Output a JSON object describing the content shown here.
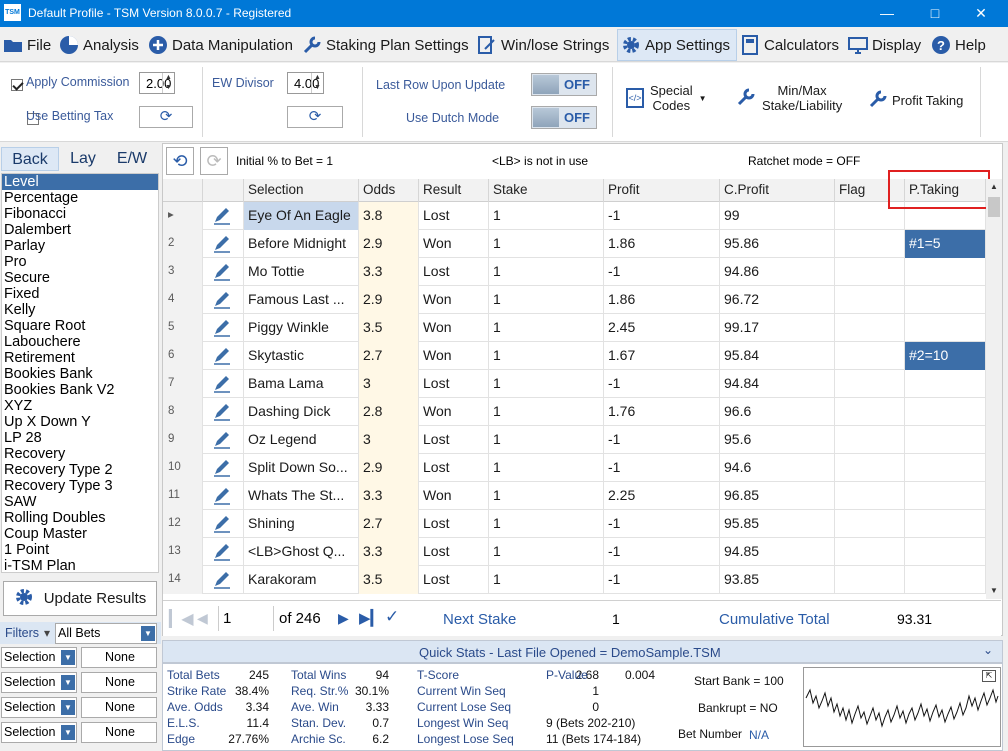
{
  "window": {
    "title": "Default Profile - TSM Version 8.0.0.7 - Registered",
    "logo": "TSM"
  },
  "menu": [
    {
      "label": "File",
      "icon": "folder-icon"
    },
    {
      "label": "Analysis",
      "icon": "pie-chart-icon"
    },
    {
      "label": "Data Manipulation",
      "icon": "plus-circle-icon"
    },
    {
      "label": "Staking Plan Settings",
      "icon": "wrench-icon"
    },
    {
      "label": "Win/lose Strings",
      "icon": "document-edit-icon"
    },
    {
      "label": "App Settings",
      "icon": "gear-icon"
    },
    {
      "label": "Calculators",
      "icon": "calculator-icon"
    },
    {
      "label": "Display",
      "icon": "monitor-icon"
    },
    {
      "label": "Help",
      "icon": "help-icon"
    }
  ],
  "toolbar": {
    "apply_commission": {
      "label": "Apply Commission",
      "checked": true,
      "value": "2.00"
    },
    "use_betting_tax": {
      "label": "Use Betting Tax",
      "checked": false
    },
    "ew_divisor": {
      "label": "EW Divisor",
      "value": "4.00"
    },
    "last_row": {
      "label": "Last Row Upon Update",
      "state": "OFF"
    },
    "dutch_mode": {
      "label": "Use Dutch Mode",
      "state": "OFF"
    },
    "special_codes": "Special\nCodes",
    "min_max": "Min/Max\nStake/Liability",
    "profit_taking": "Profit Taking"
  },
  "left": {
    "tabs": [
      "Back",
      "Lay",
      "E/W"
    ],
    "strategies": [
      "Level",
      "Percentage",
      "Fibonacci",
      "Dalembert",
      "Parlay",
      "Pro",
      "Secure",
      "Fixed",
      "Kelly",
      "Square Root",
      "Labouchere",
      "Retirement",
      "Bookies Bank",
      "Bookies Bank V2",
      "XYZ",
      "Up X Down Y",
      "LP 28",
      "Recovery",
      "Recovery Type 2",
      "Recovery Type 3",
      "SAW",
      "Rolling Doubles",
      "Coup Master",
      "1 Point",
      "i-TSM Plan"
    ],
    "selected": "Level",
    "update_button": "Update Results",
    "filters_label": "Filters",
    "filters_value": "All Bets",
    "filter_rows": [
      {
        "field": "Selection",
        "value": "None"
      },
      {
        "field": "Selection",
        "value": "None"
      },
      {
        "field": "Selection",
        "value": "None"
      },
      {
        "field": "Selection",
        "value": "None"
      }
    ]
  },
  "info": {
    "initial": "Initial % to Bet = 1",
    "lb": "<LB> is not in use",
    "ratchet": "Ratchet mode = OFF"
  },
  "grid": {
    "columns": [
      "Selection",
      "Odds",
      "Result",
      "Stake",
      "Profit",
      "C.Profit",
      "Flag",
      "P.Taking"
    ],
    "rows": [
      {
        "n": "▸",
        "selection": "Eye Of An Eagle",
        "odds": "3.8",
        "result": "Lost",
        "stake": "1",
        "profit": "-1",
        "cprofit": "99",
        "flag": "",
        "ptaking": ""
      },
      {
        "n": "2",
        "selection": "Before Midnight",
        "odds": "2.9",
        "result": "Won",
        "stake": "1",
        "profit": "1.86",
        "cprofit": "95.86",
        "flag": "",
        "ptaking": "#1=5"
      },
      {
        "n": "3",
        "selection": "Mo Tottie",
        "odds": "3.3",
        "result": "Lost",
        "stake": "1",
        "profit": "-1",
        "cprofit": "94.86",
        "flag": "",
        "ptaking": ""
      },
      {
        "n": "4",
        "selection": "Famous Last ...",
        "odds": "2.9",
        "result": "Won",
        "stake": "1",
        "profit": "1.86",
        "cprofit": "96.72",
        "flag": "",
        "ptaking": ""
      },
      {
        "n": "5",
        "selection": "Piggy Winkle",
        "odds": "3.5",
        "result": "Won",
        "stake": "1",
        "profit": "2.45",
        "cprofit": "99.17",
        "flag": "",
        "ptaking": ""
      },
      {
        "n": "6",
        "selection": "Skytastic",
        "odds": "2.7",
        "result": "Won",
        "stake": "1",
        "profit": "1.67",
        "cprofit": "95.84",
        "flag": "",
        "ptaking": "#2=10"
      },
      {
        "n": "7",
        "selection": "Bama Lama",
        "odds": "3",
        "result": "Lost",
        "stake": "1",
        "profit": "-1",
        "cprofit": "94.84",
        "flag": "",
        "ptaking": ""
      },
      {
        "n": "8",
        "selection": "Dashing Dick",
        "odds": "2.8",
        "result": "Won",
        "stake": "1",
        "profit": "1.76",
        "cprofit": "96.6",
        "flag": "",
        "ptaking": ""
      },
      {
        "n": "9",
        "selection": "Oz Legend",
        "odds": "3",
        "result": "Lost",
        "stake": "1",
        "profit": "-1",
        "cprofit": "95.6",
        "flag": "",
        "ptaking": ""
      },
      {
        "n": "10",
        "selection": "Split Down So...",
        "odds": "2.9",
        "result": "Lost",
        "stake": "1",
        "profit": "-1",
        "cprofit": "94.6",
        "flag": "",
        "ptaking": ""
      },
      {
        "n": "11",
        "selection": "Whats The St...",
        "odds": "3.3",
        "result": "Won",
        "stake": "1",
        "profit": "2.25",
        "cprofit": "96.85",
        "flag": "",
        "ptaking": ""
      },
      {
        "n": "12",
        "selection": "Shining",
        "odds": "2.7",
        "result": "Lost",
        "stake": "1",
        "profit": "-1",
        "cprofit": "95.85",
        "flag": "",
        "ptaking": ""
      },
      {
        "n": "13",
        "selection": "<LB>Ghost Q...",
        "odds": "3.3",
        "result": "Lost",
        "stake": "1",
        "profit": "-1",
        "cprofit": "94.85",
        "flag": "",
        "ptaking": ""
      },
      {
        "n": "14",
        "selection": "Karakoram",
        "odds": "3.5",
        "result": "Lost",
        "stake": "1",
        "profit": "-1",
        "cprofit": "93.85",
        "flag": "",
        "ptaking": ""
      }
    ]
  },
  "footer": {
    "page": "1",
    "of": "of 246",
    "next_stake_label": "Next Stake",
    "next_stake": "1",
    "cumulative_label": "Cumulative Total",
    "cumulative": "93.31"
  },
  "quickstats": {
    "title": "Quick Stats - Last File Opened = DemoSample.TSM",
    "col1": [
      {
        "k": "Total Bets",
        "v": "245"
      },
      {
        "k": "Strike Rate",
        "v": "38.4%"
      },
      {
        "k": "Ave. Odds",
        "v": "3.34"
      },
      {
        "k": "E.L.S.",
        "v": "11.4"
      },
      {
        "k": "Edge",
        "v": "27.76%"
      }
    ],
    "col2": [
      {
        "k": "Total Wins",
        "v": "94"
      },
      {
        "k": "Req. Str.%",
        "v": "30.1%"
      },
      {
        "k": "Ave. Win",
        "v": "3.33"
      },
      {
        "k": "Stan. Dev.",
        "v": "0.7"
      },
      {
        "k": "Archie Sc.",
        "v": "6.2"
      }
    ],
    "col3": [
      {
        "k": "T-Score",
        "v": "2.68"
      },
      {
        "k": "Current Win Seq",
        "v": "1"
      },
      {
        "k": "Current Lose Seq",
        "v": "0"
      },
      {
        "k": "Longest Win Seq",
        "v": "9  (Bets 202-210)"
      },
      {
        "k": "Longest Lose Seq",
        "v": "11  (Bets 174-184)"
      }
    ],
    "pvalue_label": "P-Value",
    "pvalue": "0.004",
    "start_bank": "Start Bank = 100",
    "bankrupt": "Bankrupt = NO",
    "bet_number_label": "Bet Number",
    "bet_number": "N/A"
  },
  "colors": {
    "accent": "#0078d7",
    "selected": "#3c6ea8",
    "highlight": "#e02020",
    "odds_bg": "#fff8e6"
  }
}
